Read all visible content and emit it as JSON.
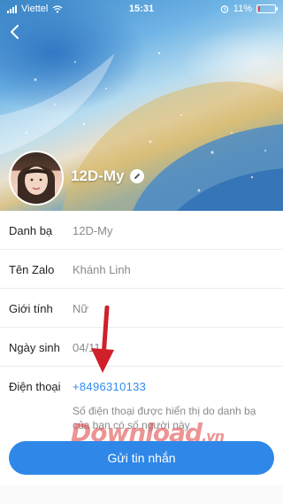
{
  "status_bar": {
    "carrier": "Viettel",
    "time": "15:31",
    "battery": "11%",
    "battery_level": 0.11
  },
  "profile": {
    "name": "12D-My"
  },
  "rows": [
    {
      "label": "Danh bạ",
      "value": "12D-My"
    },
    {
      "label": "Tên Zalo",
      "value": "Khánh Linh"
    },
    {
      "label": "Giới tính",
      "value": "Nữ"
    },
    {
      "label": "Ngày sinh",
      "value": "04/11"
    }
  ],
  "phone": {
    "label": "Điện thoại",
    "value": "+8496310133",
    "note": "Số điện thoại được hiển thị do danh bạ của bạn có số người này"
  },
  "watermark": {
    "main": "Download",
    "suffix": ".vn"
  },
  "actions": {
    "send_message": "Gửi tin nhắn"
  },
  "colors": {
    "accent": "#2f88e8",
    "phone_link": "#2f8cf0",
    "annotation": "#d0202a"
  },
  "icons": {
    "back": "chevron-left-icon",
    "edit": "pencil-icon",
    "wifi": "wifi-icon",
    "alarm": "alarm-icon",
    "battery": "battery-icon"
  }
}
